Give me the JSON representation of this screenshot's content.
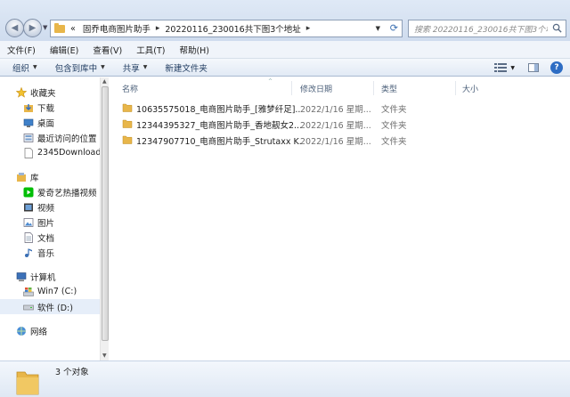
{
  "navigation": {
    "back_icon": "back-arrow-icon",
    "forward_icon": "forward-arrow-icon",
    "breadcrumb": [
      "«",
      "固乔电商图片助手",
      "20220116_230016共下图3个地址"
    ],
    "search_placeholder": "搜索 20220116_230016共下图3个地址"
  },
  "menu": {
    "items": [
      "文件(F)",
      "编辑(E)",
      "查看(V)",
      "工具(T)",
      "帮助(H)"
    ]
  },
  "toolbar": {
    "organize": "组织",
    "include_in_library": "包含到库中",
    "share": "共享",
    "new_folder": "新建文件夹"
  },
  "sidebar": {
    "favorites": {
      "label": "收藏夹",
      "items": [
        "下载",
        "桌面",
        "最近访问的位置",
        "2345Downloads"
      ]
    },
    "libraries": {
      "label": "库",
      "items": [
        "爱奇艺热播视频",
        "视频",
        "图片",
        "文档",
        "音乐"
      ]
    },
    "computer": {
      "label": "计算机",
      "items": [
        "Win7 (C:)",
        "软件 (D:)"
      ]
    },
    "network": {
      "label": "网络"
    }
  },
  "columns": {
    "name": "名称",
    "date": "修改日期",
    "type": "类型",
    "size": "大小"
  },
  "files": [
    {
      "name": "10635575018_电商图片助手_[雅梦纤足]...",
      "date": "2022/1/16 星期...",
      "type": "文件夹"
    },
    {
      "name": "12344395327_电商图片助手_香地靓女2...",
      "date": "2022/1/16 星期...",
      "type": "文件夹"
    },
    {
      "name": "12347907710_电商图片助手_Strutaxx K...",
      "date": "2022/1/16 星期...",
      "type": "文件夹"
    }
  ],
  "status": {
    "text": "3 个对象"
  },
  "colors": {
    "folder": "#e8b64a",
    "accent": "#2e6dc4"
  }
}
